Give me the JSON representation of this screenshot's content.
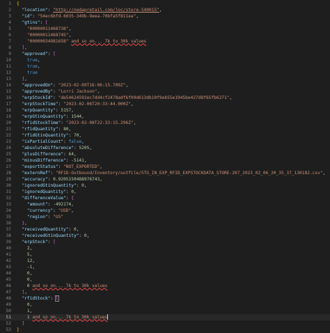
{
  "editor": {
    "lines": [
      {
        "num": "1",
        "tokens": [
          {
            "c": "br1",
            "t": "{"
          }
        ]
      },
      {
        "num": "2",
        "tokens": [
          {
            "c": "p",
            "t": "  "
          },
          {
            "c": "k",
            "t": "\"location\""
          },
          {
            "c": "p",
            "t": ": "
          },
          {
            "c": "s u",
            "t": "\"http://nedapretail.com/loc/store-540015\""
          },
          {
            "c": "p",
            "t": ","
          }
        ]
      },
      {
        "num": "3",
        "tokens": [
          {
            "c": "p",
            "t": "  "
          },
          {
            "c": "k",
            "t": "\"id\""
          },
          {
            "c": "p",
            "t": ": "
          },
          {
            "c": "s",
            "t": "\"54ec6bfd-6035-349b-9eea-70bfa5f811ea\""
          },
          {
            "c": "p",
            "t": ","
          }
        ]
      },
      {
        "num": "4",
        "tokens": [
          {
            "c": "p",
            "t": "  "
          },
          {
            "c": "k",
            "t": "\"gtins\""
          },
          {
            "c": "p",
            "t": ": "
          },
          {
            "c": "br2",
            "t": "["
          }
        ]
      },
      {
        "num": "5",
        "tokens": [
          {
            "c": "p",
            "t": "    "
          },
          {
            "c": "s",
            "t": "\"00000011468738\""
          },
          {
            "c": "p",
            "t": ","
          }
        ]
      },
      {
        "num": "6",
        "tokens": [
          {
            "c": "p",
            "t": "    "
          },
          {
            "c": "s",
            "t": "\"00000011468745\""
          },
          {
            "c": "p",
            "t": ","
          }
        ]
      },
      {
        "num": "7",
        "tokens": [
          {
            "c": "p",
            "t": "    "
          },
          {
            "c": "s",
            "t": "\"00000034981658\""
          },
          {
            "c": "p",
            "t": " "
          },
          {
            "c": "cm sq",
            "t": "and so on... 7k to 30k values"
          }
        ]
      },
      {
        "num": "8",
        "tokens": [
          {
            "c": "p",
            "t": "  "
          },
          {
            "c": "br2",
            "t": "]"
          },
          {
            "c": "p",
            "t": ","
          }
        ]
      },
      {
        "num": "9",
        "tokens": [
          {
            "c": "p",
            "t": "  "
          },
          {
            "c": "k",
            "t": "\"approved\""
          },
          {
            "c": "p",
            "t": ": "
          },
          {
            "c": "br2",
            "t": "["
          }
        ]
      },
      {
        "num": "10",
        "tokens": [
          {
            "c": "p",
            "t": "    "
          },
          {
            "c": "b",
            "t": "true"
          },
          {
            "c": "p",
            "t": ","
          }
        ]
      },
      {
        "num": "11",
        "tokens": [
          {
            "c": "p",
            "t": "    "
          },
          {
            "c": "b",
            "t": "true"
          },
          {
            "c": "p",
            "t": ","
          }
        ]
      },
      {
        "num": "12",
        "tokens": [
          {
            "c": "p",
            "t": "    "
          },
          {
            "c": "b",
            "t": "true"
          }
        ]
      },
      {
        "num": "13",
        "tokens": [
          {
            "c": "p",
            "t": "  "
          },
          {
            "c": "br2",
            "t": "]"
          },
          {
            "c": "p",
            "t": ","
          }
        ]
      },
      {
        "num": "14",
        "tokens": [
          {
            "c": "p",
            "t": "  "
          },
          {
            "c": "k",
            "t": "\"approvedOn\""
          },
          {
            "c": "p",
            "t": ": "
          },
          {
            "c": "s",
            "t": "\"2023-02-09T16:06:15.709Z\""
          },
          {
            "c": "p",
            "t": ","
          }
        ]
      },
      {
        "num": "15",
        "tokens": [
          {
            "c": "p",
            "t": "  "
          },
          {
            "c": "k",
            "t": "\"approvedBy\""
          },
          {
            "c": "p",
            "t": ": "
          },
          {
            "c": "s",
            "t": "\"Lorri Jackson\""
          },
          {
            "c": "p",
            "t": ","
          }
        ]
      },
      {
        "num": "16",
        "tokens": [
          {
            "c": "p",
            "t": "  "
          },
          {
            "c": "k",
            "t": "\"erpStockId\""
          },
          {
            "c": "p",
            "t": ": "
          },
          {
            "c": "s",
            "t": "\"de54624592ec7dd4cf2478adf6f09d613db10f9eb55e1945be427d8f65fb6271\""
          },
          {
            "c": "p",
            "t": ","
          }
        ]
      },
      {
        "num": "17",
        "tokens": [
          {
            "c": "p",
            "t": "  "
          },
          {
            "c": "k",
            "t": "\"erpStockTime\""
          },
          {
            "c": "p",
            "t": ": "
          },
          {
            "c": "s",
            "t": "\"2023-02-06T20:33:44.000Z\""
          },
          {
            "c": "p",
            "t": ","
          }
        ]
      },
      {
        "num": "18",
        "tokens": [
          {
            "c": "p",
            "t": "  "
          },
          {
            "c": "k",
            "t": "\"erpQuantity\""
          },
          {
            "c": "p",
            "t": ": "
          },
          {
            "c": "n",
            "t": "5157"
          },
          {
            "c": "p",
            "t": ","
          }
        ]
      },
      {
        "num": "19",
        "tokens": [
          {
            "c": "p",
            "t": "  "
          },
          {
            "c": "k",
            "t": "\"erpGtinQuantity\""
          },
          {
            "c": "p",
            "t": ": "
          },
          {
            "c": "n",
            "t": "1544"
          },
          {
            "c": "p",
            "t": ","
          }
        ]
      },
      {
        "num": "20",
        "tokens": [
          {
            "c": "p",
            "t": "  "
          },
          {
            "c": "k",
            "t": "\"rfidStockTime\""
          },
          {
            "c": "p",
            "t": ": "
          },
          {
            "c": "s",
            "t": "\"2023-02-08T22:33:15.296Z\""
          },
          {
            "c": "p",
            "t": ","
          }
        ]
      },
      {
        "num": "21",
        "tokens": [
          {
            "c": "p",
            "t": "  "
          },
          {
            "c": "k",
            "t": "\"rfidQuantity\""
          },
          {
            "c": "p",
            "t": ": "
          },
          {
            "c": "n",
            "t": "80"
          },
          {
            "c": "p",
            "t": ","
          }
        ]
      },
      {
        "num": "22",
        "tokens": [
          {
            "c": "p",
            "t": "  "
          },
          {
            "c": "k",
            "t": "\"rfidGtinQuantity\""
          },
          {
            "c": "p",
            "t": ": "
          },
          {
            "c": "n",
            "t": "70"
          },
          {
            "c": "p",
            "t": ","
          }
        ]
      },
      {
        "num": "23",
        "tokens": [
          {
            "c": "p",
            "t": "  "
          },
          {
            "c": "k",
            "t": "\"isPartialCount\""
          },
          {
            "c": "p",
            "t": ": "
          },
          {
            "c": "b",
            "t": "false"
          },
          {
            "c": "p",
            "t": ","
          }
        ]
      },
      {
        "num": "24",
        "tokens": [
          {
            "c": "p",
            "t": "  "
          },
          {
            "c": "k",
            "t": "\"absoluteDifference\""
          },
          {
            "c": "p",
            "t": ": "
          },
          {
            "c": "n",
            "t": "5205"
          },
          {
            "c": "p",
            "t": ","
          }
        ]
      },
      {
        "num": "25",
        "tokens": [
          {
            "c": "p",
            "t": "  "
          },
          {
            "c": "k",
            "t": "\"plusDifference\""
          },
          {
            "c": "p",
            "t": ": "
          },
          {
            "c": "n",
            "t": "64"
          },
          {
            "c": "p",
            "t": ","
          }
        ]
      },
      {
        "num": "26",
        "tokens": [
          {
            "c": "p",
            "t": "  "
          },
          {
            "c": "k",
            "t": "\"minusDifference\""
          },
          {
            "c": "p",
            "t": ": "
          },
          {
            "c": "n",
            "t": "-5141"
          },
          {
            "c": "p",
            "t": ","
          }
        ]
      },
      {
        "num": "27",
        "tokens": [
          {
            "c": "p",
            "t": "  "
          },
          {
            "c": "k",
            "t": "\"exportStatus\""
          },
          {
            "c": "p",
            "t": ": "
          },
          {
            "c": "s",
            "t": "\"NOT_EXPORTED\""
          },
          {
            "c": "p",
            "t": ","
          }
        ]
      },
      {
        "num": "28",
        "tokens": [
          {
            "c": "p",
            "t": "  "
          },
          {
            "c": "k",
            "t": "\"externRef\""
          },
          {
            "c": "p",
            "t": ": "
          },
          {
            "c": "s",
            "t": "\"RFID-Outbound/Inventory/outfile/STG_IN_EXP_RFID_EXPSTOCKDATA_STORE-207_2023_02_06_20_35_37_130182.csv\""
          },
          {
            "c": "p",
            "t": ","
          }
        ]
      },
      {
        "num": "29",
        "tokens": [
          {
            "c": "p",
            "t": "  "
          },
          {
            "c": "k",
            "t": "\"accuracy\""
          },
          {
            "c": "p",
            "t": ": "
          },
          {
            "c": "n",
            "t": "0.9205150488976743"
          },
          {
            "c": "p",
            "t": ","
          }
        ]
      },
      {
        "num": "30",
        "tokens": [
          {
            "c": "p",
            "t": "  "
          },
          {
            "c": "k",
            "t": "\"ignoredGtinQuantity\""
          },
          {
            "c": "p",
            "t": ": "
          },
          {
            "c": "n",
            "t": "0"
          },
          {
            "c": "p",
            "t": ","
          }
        ]
      },
      {
        "num": "31",
        "tokens": [
          {
            "c": "p",
            "t": "  "
          },
          {
            "c": "k",
            "t": "\"ignoredQuantity\""
          },
          {
            "c": "p",
            "t": ": "
          },
          {
            "c": "n",
            "t": "0"
          },
          {
            "c": "p",
            "t": ","
          }
        ]
      },
      {
        "num": "32",
        "tokens": [
          {
            "c": "p",
            "t": "  "
          },
          {
            "c": "k",
            "t": "\"differenceValue\""
          },
          {
            "c": "p",
            "t": ": "
          },
          {
            "c": "br2",
            "t": "{"
          }
        ]
      },
      {
        "num": "33",
        "tokens": [
          {
            "c": "p",
            "t": "    "
          },
          {
            "c": "k",
            "t": "\"amount\""
          },
          {
            "c": "p",
            "t": ": "
          },
          {
            "c": "n",
            "t": "-492174"
          },
          {
            "c": "p",
            "t": ","
          }
        ]
      },
      {
        "num": "34",
        "tokens": [
          {
            "c": "p",
            "t": "    "
          },
          {
            "c": "k",
            "t": "\"currency\""
          },
          {
            "c": "p",
            "t": ": "
          },
          {
            "c": "s",
            "t": "\"USD\""
          },
          {
            "c": "p",
            "t": ","
          }
        ]
      },
      {
        "num": "35",
        "tokens": [
          {
            "c": "p",
            "t": "    "
          },
          {
            "c": "k",
            "t": "\"region\""
          },
          {
            "c": "p",
            "t": ": "
          },
          {
            "c": "s",
            "t": "\"US\""
          }
        ]
      },
      {
        "num": "36",
        "tokens": [
          {
            "c": "p",
            "t": "  "
          },
          {
            "c": "br2",
            "t": "}"
          },
          {
            "c": "p",
            "t": ","
          }
        ]
      },
      {
        "num": "37",
        "tokens": [
          {
            "c": "p",
            "t": "  "
          },
          {
            "c": "k",
            "t": "\"receivedQuantity\""
          },
          {
            "c": "p",
            "t": ": "
          },
          {
            "c": "n",
            "t": "0"
          },
          {
            "c": "p",
            "t": ","
          }
        ]
      },
      {
        "num": "38",
        "tokens": [
          {
            "c": "p",
            "t": "  "
          },
          {
            "c": "k",
            "t": "\"receivedGtinQuantity\""
          },
          {
            "c": "p",
            "t": ": "
          },
          {
            "c": "n",
            "t": "0"
          },
          {
            "c": "p",
            "t": ","
          }
        ]
      },
      {
        "num": "39",
        "tokens": [
          {
            "c": "p",
            "t": "  "
          },
          {
            "c": "k",
            "t": "\"erpStock\""
          },
          {
            "c": "p",
            "t": ": "
          },
          {
            "c": "br2",
            "t": "["
          }
        ]
      },
      {
        "num": "40",
        "tokens": [
          {
            "c": "p",
            "t": "    "
          },
          {
            "c": "n",
            "t": "2"
          },
          {
            "c": "p",
            "t": ","
          }
        ]
      },
      {
        "num": "41",
        "tokens": [
          {
            "c": "p",
            "t": "    "
          },
          {
            "c": "n",
            "t": "5"
          },
          {
            "c": "p",
            "t": ","
          }
        ]
      },
      {
        "num": "42",
        "tokens": [
          {
            "c": "p",
            "t": "    "
          },
          {
            "c": "n",
            "t": "12"
          },
          {
            "c": "p",
            "t": ","
          }
        ]
      },
      {
        "num": "43",
        "tokens": [
          {
            "c": "p",
            "t": "    "
          },
          {
            "c": "n",
            "t": "-1"
          },
          {
            "c": "p",
            "t": ","
          }
        ]
      },
      {
        "num": "44",
        "tokens": [
          {
            "c": "p",
            "t": "    "
          },
          {
            "c": "n",
            "t": "0"
          },
          {
            "c": "p",
            "t": ","
          }
        ]
      },
      {
        "num": "45",
        "tokens": [
          {
            "c": "p",
            "t": "    "
          },
          {
            "c": "n",
            "t": "0"
          },
          {
            "c": "p",
            "t": ","
          }
        ]
      },
      {
        "num": "46",
        "tokens": [
          {
            "c": "p",
            "t": "    "
          },
          {
            "c": "n",
            "t": "0"
          },
          {
            "c": "p",
            "t": " "
          },
          {
            "c": "cm sq",
            "t": "and so on... 7k to 30k values"
          }
        ]
      },
      {
        "num": "47",
        "tokens": [
          {
            "c": "p",
            "t": "  "
          },
          {
            "c": "br2",
            "t": "]"
          },
          {
            "c": "p",
            "t": ","
          }
        ]
      },
      {
        "num": "48",
        "tokens": [
          {
            "c": "p",
            "t": "  "
          },
          {
            "c": "k",
            "t": "\"rfidStock\""
          },
          {
            "c": "p",
            "t": ": "
          },
          {
            "c": "br2 hl-bracket",
            "t": "["
          }
        ]
      },
      {
        "num": "49",
        "tokens": [
          {
            "c": "p",
            "t": "    "
          },
          {
            "c": "n",
            "t": "0"
          },
          {
            "c": "p",
            "t": ","
          }
        ]
      },
      {
        "num": "50",
        "tokens": [
          {
            "c": "p",
            "t": "    "
          },
          {
            "c": "n",
            "t": "1"
          },
          {
            "c": "p",
            "t": ","
          }
        ]
      },
      {
        "num": "51",
        "current": true,
        "tokens": [
          {
            "c": "p",
            "t": "    "
          },
          {
            "c": "n",
            "t": "1"
          },
          {
            "c": "p",
            "t": " "
          },
          {
            "c": "cm sq",
            "t": "and so on... 7k to 30k values"
          }
        ]
      },
      {
        "num": "52",
        "tokens": [
          {
            "c": "p",
            "t": "  "
          },
          {
            "c": "br2",
            "t": "]"
          }
        ]
      },
      {
        "num": "53",
        "tokens": [
          {
            "c": "br1",
            "t": "}"
          }
        ]
      }
    ]
  }
}
